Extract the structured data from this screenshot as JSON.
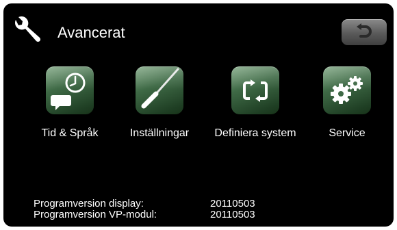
{
  "header": {
    "title": "Avancerat",
    "icon": "wrench-icon",
    "back_icon": "back-arrow-icon"
  },
  "apps": [
    {
      "label": "Tid & Språk",
      "icon": "clock-speech-icon"
    },
    {
      "label": "Inställningar",
      "icon": "screwdriver-icon"
    },
    {
      "label": "Definiera system",
      "icon": "cycle-arrows-icon"
    },
    {
      "label": "Service",
      "icon": "gears-icon"
    }
  ],
  "info": [
    {
      "label": "Programversion display:",
      "value": "20110503"
    },
    {
      "label": "Programversion VP-modul:",
      "value": "20110503"
    }
  ],
  "colors": {
    "background": "#000000",
    "text": "#ffffff",
    "tile_green": "#3f6a46",
    "button_gray": "#6e6e6e"
  }
}
